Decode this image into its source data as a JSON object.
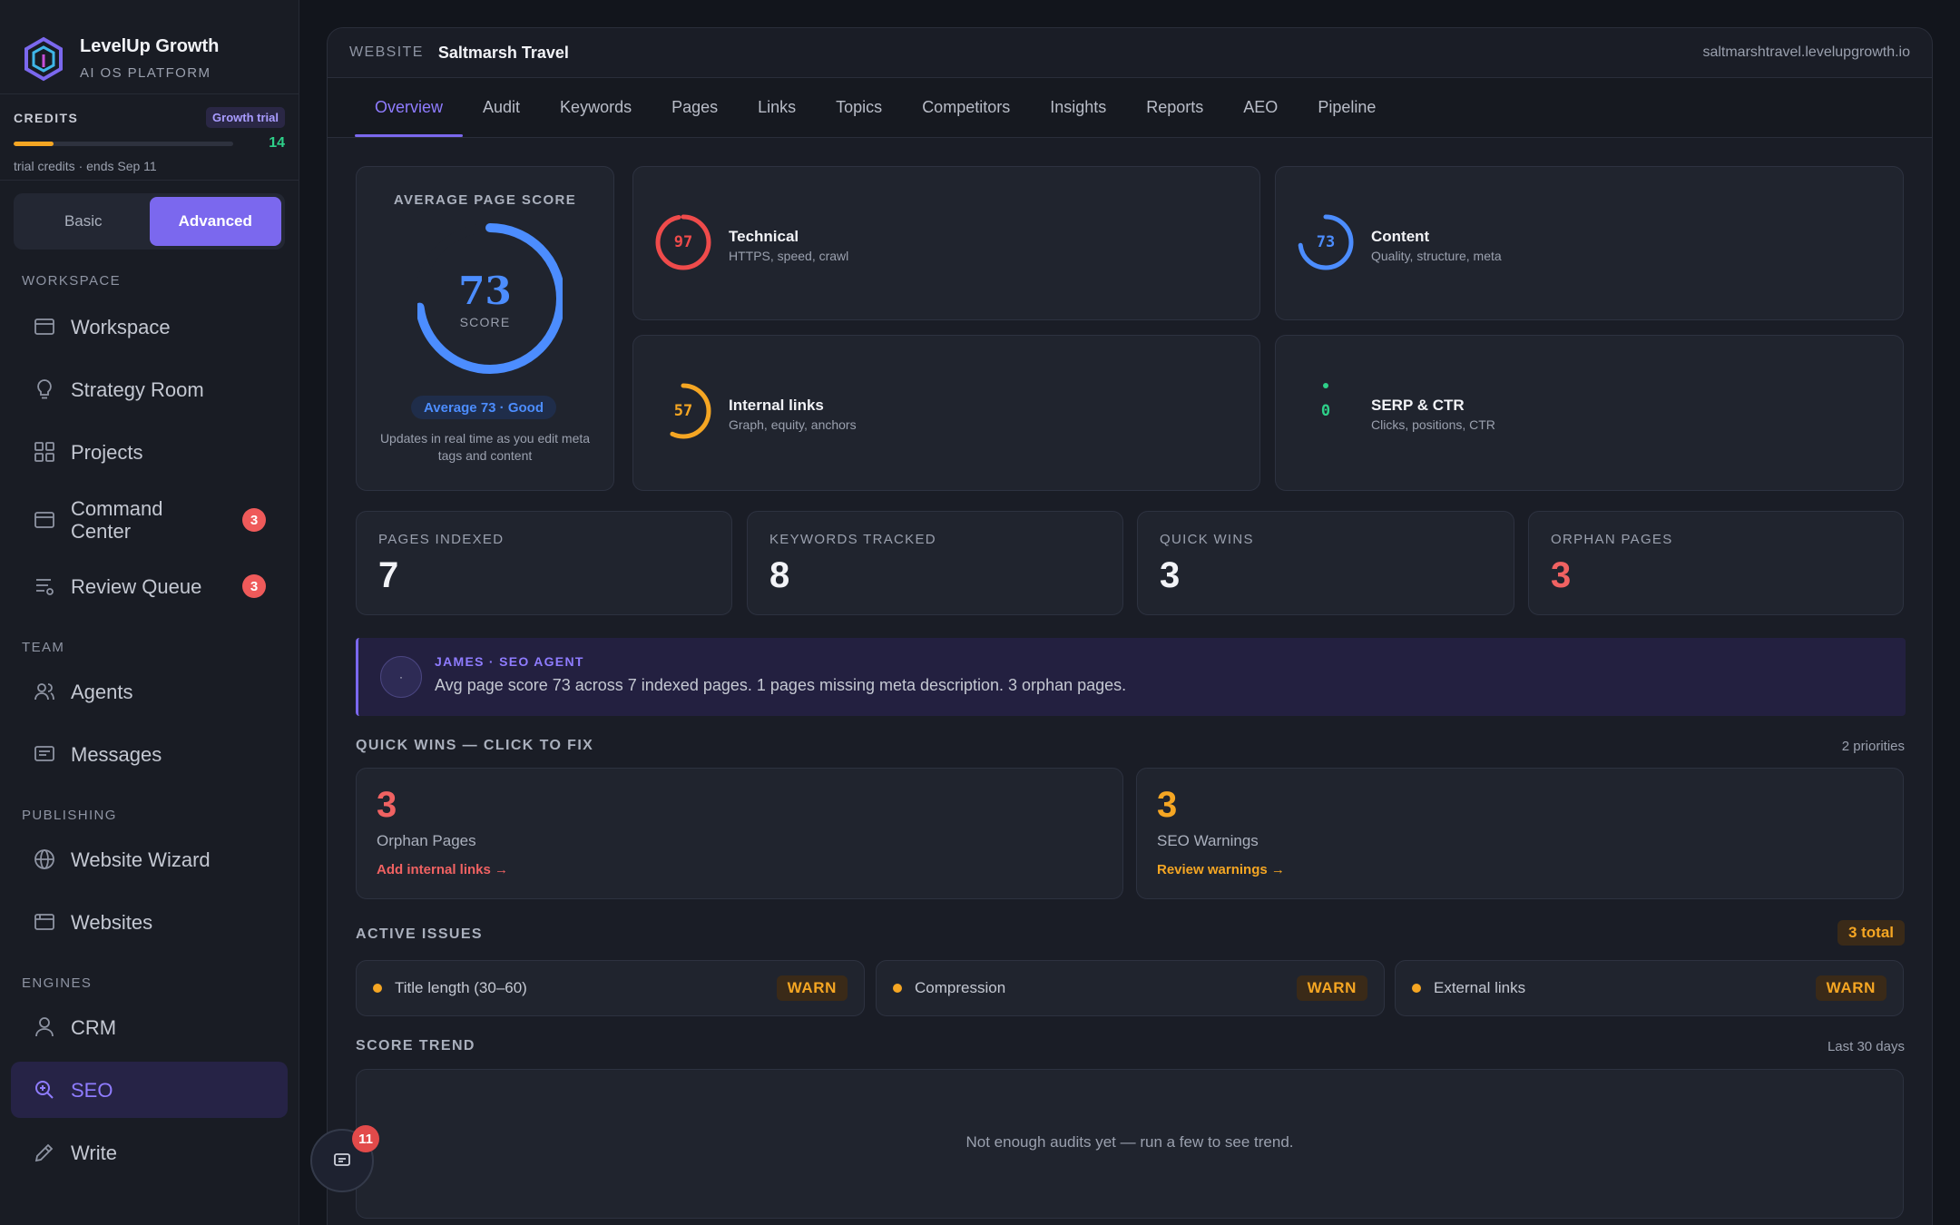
{
  "brand": {
    "name": "LevelUp Growth",
    "subtitle": "AI OS PLATFORM"
  },
  "credits": {
    "label": "CREDITS",
    "badge": "Growth trial",
    "remaining": "14",
    "progress_fraction": 0.18,
    "note": "trial credits · ends Sep 11"
  },
  "mode": {
    "basic": "Basic",
    "advanced": "Advanced",
    "selected": "Advanced"
  },
  "nav": {
    "sections": {
      "workspace": "WORKSPACE",
      "team": "TEAM",
      "publishing": "PUBLISHING",
      "engines": "ENGINES"
    },
    "items": {
      "workspace": {
        "label": "Workspace",
        "icon": "layout-icon"
      },
      "strategy": {
        "label": "Strategy Room",
        "icon": "lightbulb-icon"
      },
      "projects": {
        "label": "Projects",
        "icon": "grid-icon"
      },
      "command": {
        "label": "Command Center",
        "icon": "monitor-icon",
        "badge": "3"
      },
      "review": {
        "label": "Review Queue",
        "icon": "list-check-icon",
        "badge": "3"
      },
      "agents": {
        "label": "Agents",
        "icon": "users-icon"
      },
      "messages": {
        "label": "Messages",
        "icon": "message-icon"
      },
      "wizard": {
        "label": "Website Wizard",
        "icon": "globe-icon"
      },
      "websites": {
        "label": "Websites",
        "icon": "browser-icon"
      },
      "crm": {
        "label": "CRM",
        "icon": "user-icon"
      },
      "seo": {
        "label": "SEO",
        "icon": "search-icon",
        "active": true
      },
      "write": {
        "label": "Write",
        "icon": "pencil-icon"
      }
    }
  },
  "header": {
    "website_label": "WEBSITE",
    "website_name": "Saltmarsh Travel",
    "url": "saltmarshtravel.levelupgrowth.io"
  },
  "tabs": [
    "Overview",
    "Audit",
    "Keywords",
    "Pages",
    "Links",
    "Topics",
    "Competitors",
    "Insights",
    "Reports",
    "AEO",
    "Pipeline"
  ],
  "active_tab": "Overview",
  "average_score": {
    "title": "AVERAGE PAGE SCORE",
    "value": "73",
    "value_fraction": 0.73,
    "unit_label": "SCORE",
    "pill": "Average 73 · Good",
    "note": "Updates in real time as you edit meta tags and content",
    "color": "#4c8dff"
  },
  "sub_scores": {
    "technical": {
      "value": "97",
      "fraction": 0.97,
      "title": "Technical",
      "desc": "HTTPS, speed, crawl",
      "color": "#ef4b4b"
    },
    "content": {
      "value": "73",
      "fraction": 0.73,
      "title": "Content",
      "desc": "Quality, structure, meta",
      "color": "#4c8dff"
    },
    "links": {
      "value": "57",
      "fraction": 0.57,
      "title": "Internal links",
      "desc": "Graph, equity, anchors",
      "color": "#f5a623"
    },
    "serp": {
      "value": "0",
      "fraction": 0.0,
      "title": "SERP & CTR",
      "desc": "Clicks, positions, CTR",
      "color": "#2ed089"
    }
  },
  "stats": {
    "indexed": {
      "label": "PAGES INDEXED",
      "value": "7"
    },
    "keywords": {
      "label": "KEYWORDS TRACKED",
      "value": "8"
    },
    "quickwins": {
      "label": "QUICK WINS",
      "value": "3"
    },
    "orphans": {
      "label": "ORPHAN PAGES",
      "value": "3"
    }
  },
  "agent": {
    "name": "JAMES · SEO AGENT",
    "message": "Avg page score 73 across 7 indexed pages. 1 pages missing meta description. 3 orphan pages.",
    "avatar": "·"
  },
  "quick_wins": {
    "title": "QUICK WINS — CLICK TO FIX",
    "meta": "2 priorities",
    "items": [
      {
        "count": "3",
        "label": "Orphan Pages",
        "action": "Add internal links →",
        "color": "#f06262"
      },
      {
        "count": "3",
        "label": "SEO Warnings",
        "action": "Review warnings →",
        "color": "#f5a623"
      }
    ]
  },
  "active_issues": {
    "title": "ACTIVE ISSUES",
    "total": "3 total",
    "items": [
      {
        "label": "Title length (30–60)",
        "status": "WARN"
      },
      {
        "label": "Compression",
        "status": "WARN"
      },
      {
        "label": "External links",
        "status": "WARN"
      }
    ]
  },
  "score_trend": {
    "title": "SCORE TREND",
    "meta": "Last 30 days",
    "empty": "Not enough audits yet — run a few to see trend."
  },
  "chat": {
    "unread": "11",
    "icon": "chat-icon"
  }
}
